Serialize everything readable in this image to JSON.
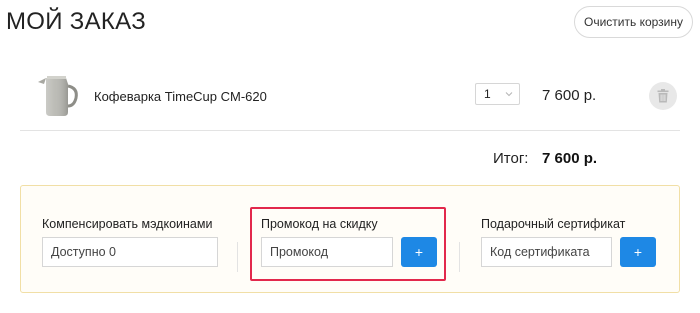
{
  "header": {
    "title": "МОЙ ЗАКАЗ",
    "clear_cart_label": "Очистить корзину"
  },
  "cart": {
    "items": [
      {
        "name": "Кофеварка TimeCup CM-620",
        "quantity": "1",
        "price": "7 600 р.",
        "image_icon": "coffee-pot-image"
      }
    ],
    "total_label": "Итог:",
    "total_value": "7 600 р."
  },
  "promo": {
    "coins": {
      "label": "Компенсировать мэдкоинами",
      "placeholder": "Доступно 0"
    },
    "promocode": {
      "label": "Промокод на скидку",
      "placeholder": "Промокод",
      "button": "+"
    },
    "certificate": {
      "label": "Подарочный сертификат",
      "placeholder": "Код сертификата",
      "button": "+"
    }
  },
  "colors": {
    "accent": "#1e88e5",
    "highlight": "#e2284c",
    "panel_border": "#f1dfa6"
  }
}
